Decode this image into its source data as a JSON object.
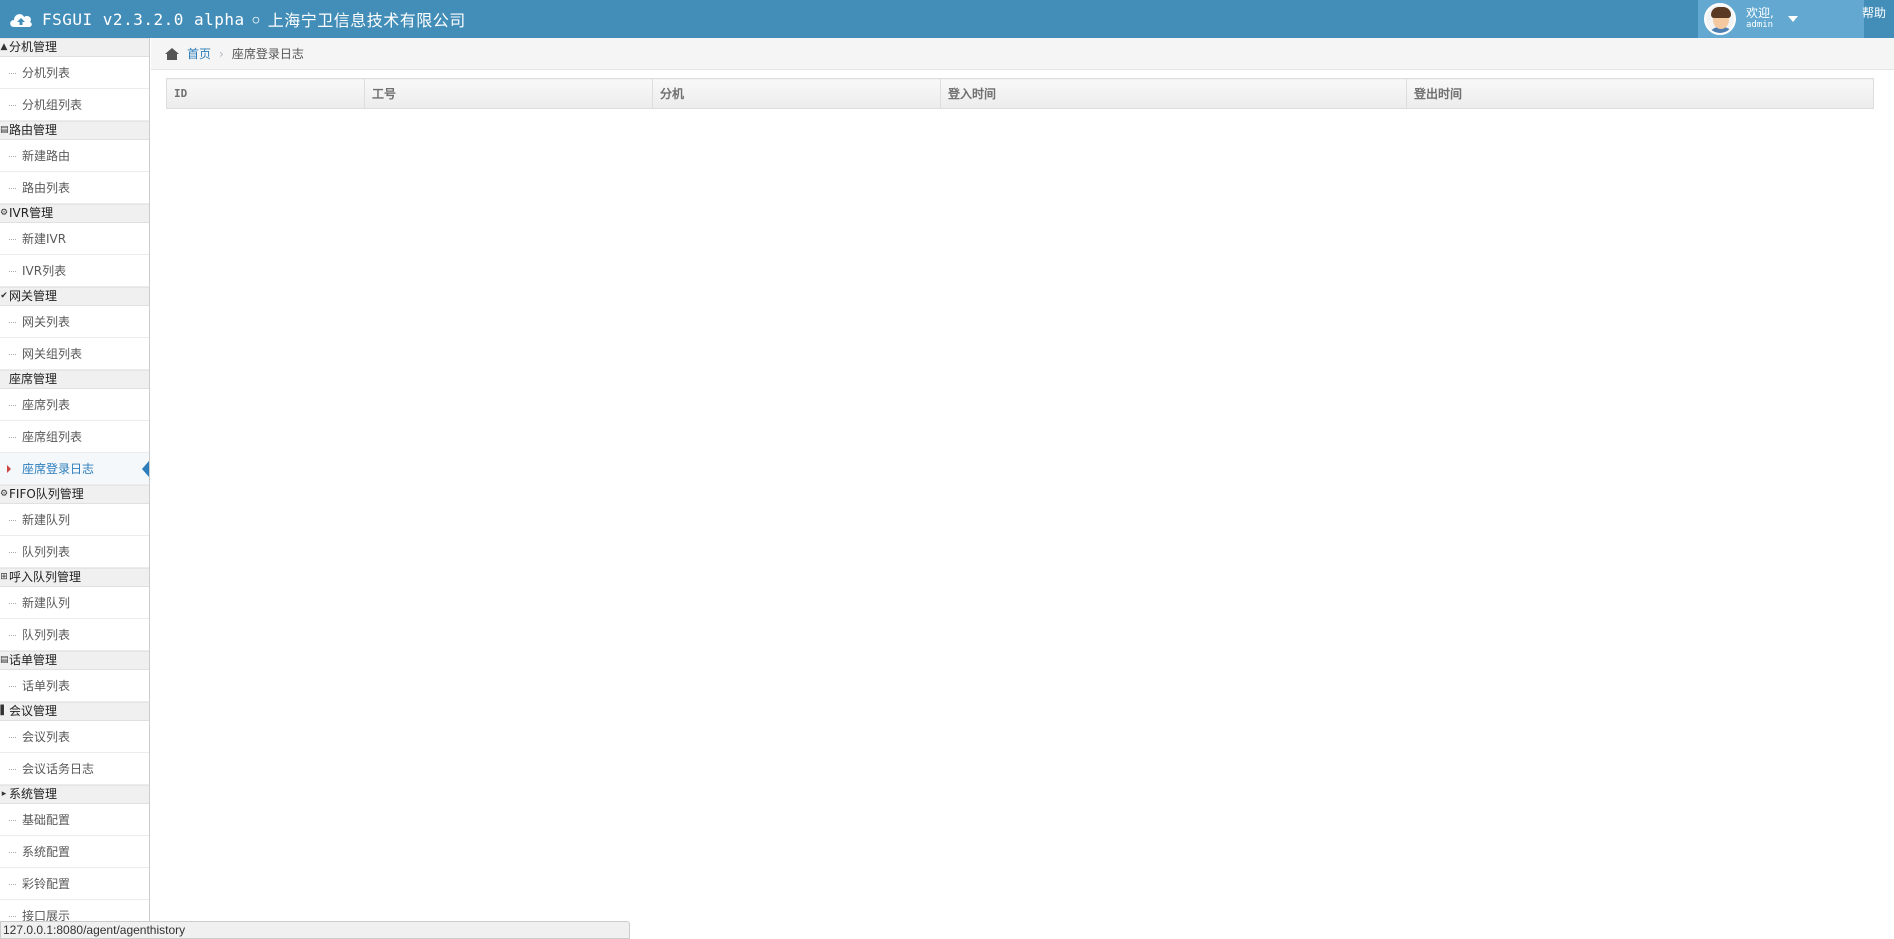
{
  "navbar": {
    "brand_title": "FSGUI v2.3.2.0 alpha",
    "company": "上海宁卫信息技术有限公司",
    "welcome": "欢迎,",
    "username": "admin",
    "help": "帮助",
    "color": "#438eb9"
  },
  "sidebar": {
    "groups": [
      {
        "label": "分机管理",
        "icon": "▲",
        "items": [
          "分机列表",
          "分机组列表"
        ]
      },
      {
        "label": "路由管理",
        "icon": "▤",
        "items": [
          "新建路由",
          "路由列表"
        ]
      },
      {
        "label": "IVR管理",
        "icon": "⚙",
        "items": [
          "新建IVR",
          "IVR列表"
        ]
      },
      {
        "label": "网关管理",
        "icon": "✔",
        "items": [
          "网关列表",
          "网关组列表"
        ]
      },
      {
        "label": "座席管理",
        "icon": "",
        "items": [
          "座席列表",
          "座席组列表",
          "座席登录日志"
        ],
        "active_index": 2
      },
      {
        "label": "FIFO队列管理",
        "icon": "⚙",
        "items": [
          "新建队列",
          "队列列表"
        ]
      },
      {
        "label": "呼入队列管理",
        "icon": "⊞",
        "items": [
          "新建队列",
          "队列列表"
        ]
      },
      {
        "label": "话单管理",
        "icon": "▤",
        "items": [
          "话单列表"
        ]
      },
      {
        "label": "会议管理",
        "icon": "▌",
        "items": [
          "会议列表",
          "会议话务日志"
        ]
      },
      {
        "label": "系统管理",
        "icon": "▸",
        "items": [
          "基础配置",
          "系统配置",
          "彩铃配置",
          "接口展示"
        ]
      }
    ]
  },
  "breadcrumb": {
    "home": "首页",
    "current": "座席登录日志"
  },
  "table": {
    "columns": [
      "ID",
      "工号",
      "分机",
      "登入时间",
      "登出时间"
    ]
  },
  "status_bar": {
    "url": "127.0.0.1:8080/agent/agenthistory"
  }
}
